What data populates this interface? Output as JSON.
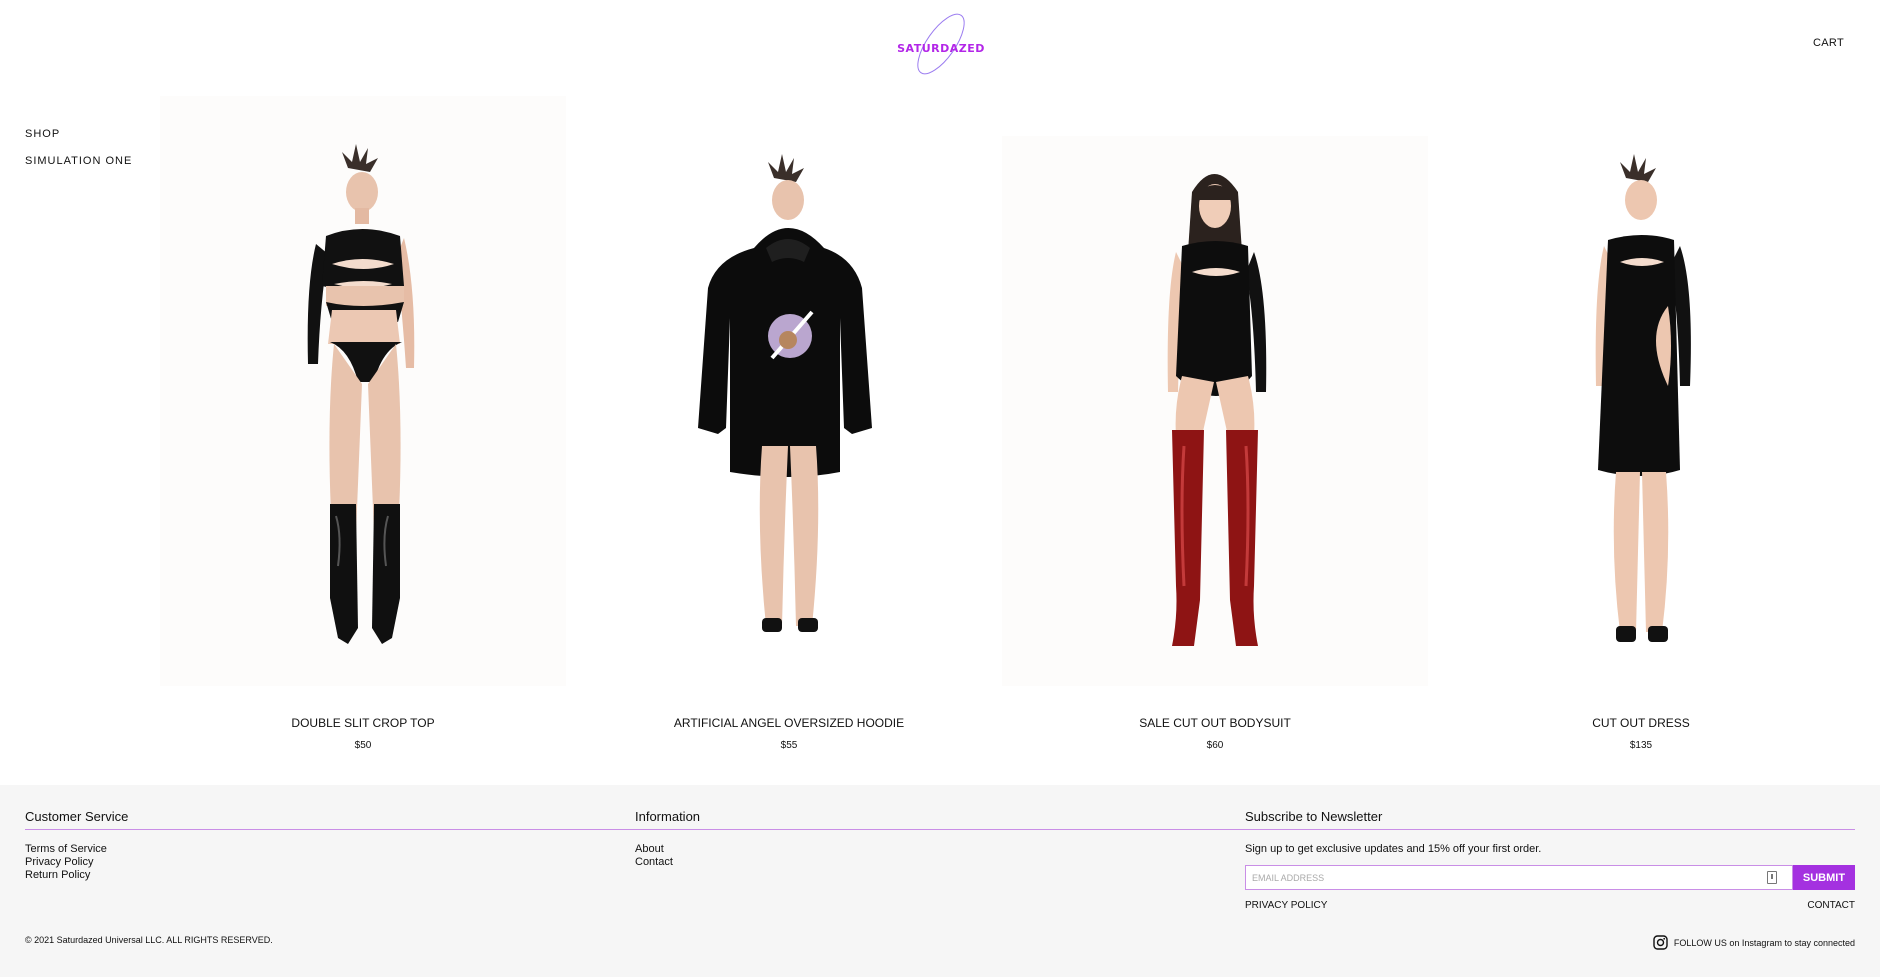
{
  "header": {
    "logo_text": "SATURDAZED",
    "cart_label": "CART"
  },
  "sidenav": {
    "items": [
      {
        "label": "SHOP"
      },
      {
        "label": "SIMULATION ONE"
      }
    ]
  },
  "products": [
    {
      "title": "DOUBLE SLIT CROP TOP",
      "price": "$50"
    },
    {
      "title": "ARTIFICIAL ANGEL OVERSIZED HOODIE",
      "price": "$55"
    },
    {
      "title": "SALE CUT OUT BODYSUIT",
      "price": "$60"
    },
    {
      "title": "CUT OUT DRESS",
      "price": "$135"
    }
  ],
  "footer": {
    "customer_service": {
      "heading": "Customer Service",
      "links": [
        "Terms of Service",
        "Privacy Policy",
        "Return Policy"
      ]
    },
    "information": {
      "heading": "Information",
      "links": [
        "About",
        "Contact"
      ]
    },
    "newsletter": {
      "heading": "Subscribe to Newsletter",
      "text": "Sign up to get exclusive updates and 15% off your first order.",
      "placeholder": "EMAIL ADDRESS",
      "submit_label": "SUBMIT"
    },
    "privacy_label": "PRIVACY POLICY",
    "contact_label": "CONTACT",
    "copyright": "© 2021 Saturdazed Universal LLC. ALL RIGHTS RESERVED.",
    "follow_text": "FOLLOW US on Instagram to stay connected"
  },
  "colors": {
    "accent": "#a431e0",
    "logo": "#b326e8",
    "rule": "#c98ee6",
    "footer_bg": "#f6f6f6"
  }
}
